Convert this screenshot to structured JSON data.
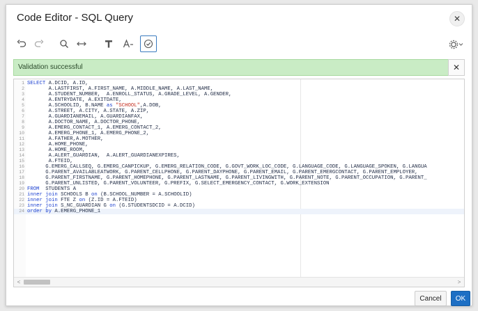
{
  "dialog": {
    "title": "Code Editor - SQL Query",
    "close_glyph": "✕"
  },
  "toolbar": {
    "undo_glyph": "↶",
    "redo_glyph": "↷",
    "search_glyph": "⚲",
    "replace_glyph": "↔",
    "format_glyph": "¶",
    "font_size_glyph": "A",
    "validate_glyph": "✓",
    "settings_glyph": "⚙",
    "icons": [
      "undo-icon",
      "redo-icon",
      "search-icon",
      "replace-icon",
      "format-icon",
      "font-size-icon",
      "validate-icon",
      "settings-icon"
    ]
  },
  "alert": {
    "message": "Validation successful",
    "close_glyph": "✕",
    "color": "#c9ecc5"
  },
  "editor": {
    "active_line": 24,
    "lines": [
      {
        "n": "1",
        "segments": [
          [
            "kw",
            "SELECT "
          ],
          [
            "t",
            "A.DCID, A.ID,"
          ]
        ]
      },
      {
        "n": "2",
        "segments": [
          [
            "t",
            "       A.LASTFIRST, A.FIRST_NAME, A.MIDDLE_NAME, A.LAST_NAME,"
          ]
        ]
      },
      {
        "n": "3",
        "segments": [
          [
            "t",
            "       A.STUDENT_NUMBER,  A.ENROLL_STATUS, A.GRADE_LEVEL, A.GENDER,"
          ]
        ]
      },
      {
        "n": "4",
        "segments": [
          [
            "t",
            "       A.ENTRYDATE, A.EXITDATE,"
          ]
        ]
      },
      {
        "n": "5",
        "segments": [
          [
            "t",
            "       A.SCHOOLID, B.NAME "
          ],
          [
            "kw",
            "as "
          ],
          [
            "str",
            "\"SCHOOL\""
          ],
          [
            "t",
            ",A.DOB,"
          ]
        ]
      },
      {
        "n": "6",
        "segments": [
          [
            "t",
            "       A.STREET, A.CITY, A.STATE, A.ZIP,"
          ]
        ]
      },
      {
        "n": "7",
        "segments": [
          [
            "t",
            "       A.GUARDIANEMAIL, A.GUARDIANFAX,"
          ]
        ]
      },
      {
        "n": "8",
        "segments": [
          [
            "t",
            "       A.DOCTOR_NAME, A.DOCTOR_PHONE,"
          ]
        ]
      },
      {
        "n": "9",
        "segments": [
          [
            "t",
            "       A.EMERG_CONTACT_1, A.EMERG_CONTACT_2,"
          ]
        ]
      },
      {
        "n": "10",
        "segments": [
          [
            "t",
            "       A.EMERG_PHONE_1, A.EMERG_PHONE_2,"
          ]
        ]
      },
      {
        "n": "11",
        "segments": [
          [
            "t",
            "       A.FATHER,A.MOTHER,"
          ]
        ]
      },
      {
        "n": "12",
        "segments": [
          [
            "t",
            "       A.HOME_PHONE,"
          ]
        ]
      },
      {
        "n": "13",
        "segments": [
          [
            "t",
            "       A.HOME_ROOM,"
          ]
        ]
      },
      {
        "n": "14",
        "segments": [
          [
            "t",
            "       A.ALERT_GUARDIAN,  A.ALERT_GUARDIANEXPIRES,"
          ]
        ]
      },
      {
        "n": "15",
        "segments": [
          [
            "t",
            "       A.FTEID,"
          ]
        ]
      },
      {
        "n": "16",
        "segments": [
          [
            "t",
            "      G.EMERG_CALLSEQ, G.EMERG_CANPICKUP, G.EMERG_RELATION_CODE, G.GOVT_WORK_LOC_CODE, G.LANGUAGE_CODE, G.LANGUAGE_SPOKEN, G.LANGUA"
          ]
        ]
      },
      {
        "n": "17",
        "segments": [
          [
            "t",
            "      G.PARENT_AVAILABLEATWORK, G.PARENT_CELLPHONE, G.PARENT_DAYPHONE, G.PARENT_EMAIL, G.PARENT_EMERGCONTACT, G.PARENT_EMPLOYER,"
          ]
        ]
      },
      {
        "n": "18",
        "segments": [
          [
            "t",
            "      G.PARENT_FIRSTNAME, G.PARENT_HOMEPHONE, G.PARENT_LASTNAME, G.PARENT_LIVINGWITH, G.PARENT_NOTE, G.PARENT_OCCUPATION, G.PARENT_"
          ]
        ]
      },
      {
        "n": "19",
        "segments": [
          [
            "t",
            "      G.PARENT_UNLISTED, G.PARENT_VOLUNTEER, G.PREFIX, G.SELECT_EMERGENCY_CONTACT, G.WORK_EXTENSION"
          ]
        ]
      },
      {
        "n": "20",
        "segments": [
          [
            "kw",
            "FROM  "
          ],
          [
            "t",
            "STUDENTS A"
          ]
        ]
      },
      {
        "n": "21",
        "segments": [
          [
            "kw",
            "inner join "
          ],
          [
            "t",
            "SCHOOLS B "
          ],
          [
            "kw",
            "on "
          ],
          [
            "t",
            "(B.SCHOOL_NUMBER = A.SCHOOLID)"
          ]
        ]
      },
      {
        "n": "22",
        "segments": [
          [
            "kw",
            "inner join "
          ],
          [
            "t",
            "FTE Z "
          ],
          [
            "kw",
            "on "
          ],
          [
            "t",
            "(Z.ID = A.FTEID)"
          ]
        ]
      },
      {
        "n": "23",
        "segments": [
          [
            "kw",
            "inner join "
          ],
          [
            "t",
            "S_NC_GUARDIAN G "
          ],
          [
            "kw",
            "on "
          ],
          [
            "t",
            "(G.STUDENTSDCID = A.DCID)"
          ]
        ]
      },
      {
        "n": "24",
        "segments": [
          [
            "kw",
            "order by "
          ],
          [
            "t",
            "A.EMERG_PHONE_1"
          ]
        ]
      }
    ],
    "scroll_left_glyph": "<",
    "scroll_right_glyph": ">"
  },
  "footer": {
    "cancel_label": "Cancel",
    "ok_label": "OK"
  },
  "colors": {
    "keyword": "#1a3fd0",
    "string": "#c42b1c",
    "ok_button": "#1d6fc4"
  }
}
